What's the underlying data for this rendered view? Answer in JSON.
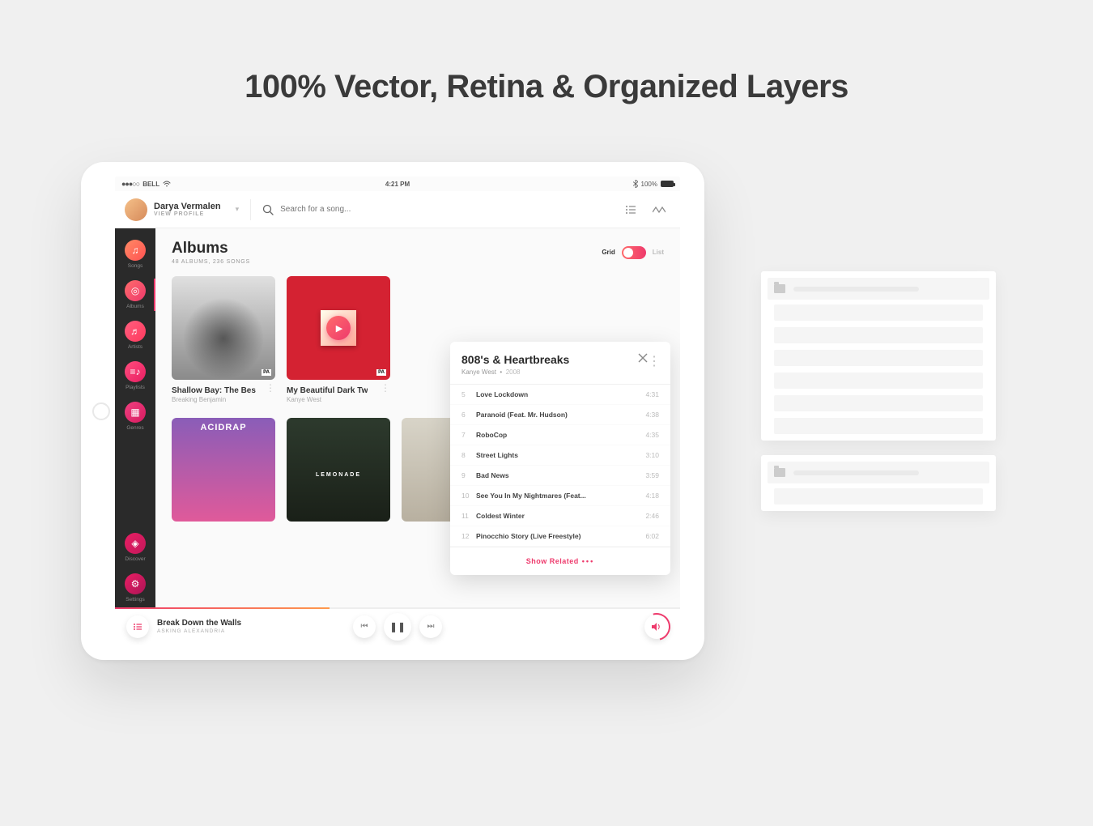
{
  "headline": "100% Vector, Retina & Organized Layers",
  "statusbar": {
    "carrier": "BELL",
    "time": "4:21 PM",
    "battery": "100%"
  },
  "user": {
    "name": "Darya Vermalen",
    "profile_link": "VIEW PROFILE"
  },
  "search": {
    "placeholder": "Search for a song..."
  },
  "sidebar": [
    {
      "key": "songs",
      "label": "Songs"
    },
    {
      "key": "albums",
      "label": "Albums"
    },
    {
      "key": "artists",
      "label": "Artists"
    },
    {
      "key": "playlists",
      "label": "Playlists"
    },
    {
      "key": "genres",
      "label": "Genres"
    },
    {
      "key": "discover",
      "label": "Discover"
    },
    {
      "key": "settings",
      "label": "Settings"
    }
  ],
  "section": {
    "title": "Albums",
    "subtitle": "48 ALBUMS, 236 SONGS"
  },
  "view": {
    "grid": "Grid",
    "list": "List"
  },
  "albums_row1": [
    {
      "title": "Shallow Bay: The Bes",
      "artist": "Breaking Benjamin"
    },
    {
      "title": "My Beautiful Dark Tw",
      "artist": "Kanye West"
    }
  ],
  "popup": {
    "title": "808's & Heartbreaks",
    "artist": "Kanye West",
    "year": "2008",
    "tracks": [
      {
        "num": "5",
        "name": "Love Lockdown",
        "time": "4:31"
      },
      {
        "num": "6",
        "name": "Paranoid (Feat. Mr. Hudson)",
        "time": "4:38"
      },
      {
        "num": "7",
        "name": "RoboCop",
        "time": "4:35"
      },
      {
        "num": "8",
        "name": "Street Lights",
        "time": "3:10"
      },
      {
        "num": "9",
        "name": "Bad News",
        "time": "3:59"
      },
      {
        "num": "10",
        "name": "See You In My Nightmares (Feat...",
        "time": "4:18"
      },
      {
        "num": "11",
        "name": "Coldest Winter",
        "time": "2:46"
      },
      {
        "num": "12",
        "name": "Pinocchio Story (Live Freestyle)",
        "time": "6:02"
      }
    ],
    "related": "Show Related"
  },
  "player": {
    "track": "Break Down the Walls",
    "artist": "ASKING ALEXANDRIA"
  }
}
